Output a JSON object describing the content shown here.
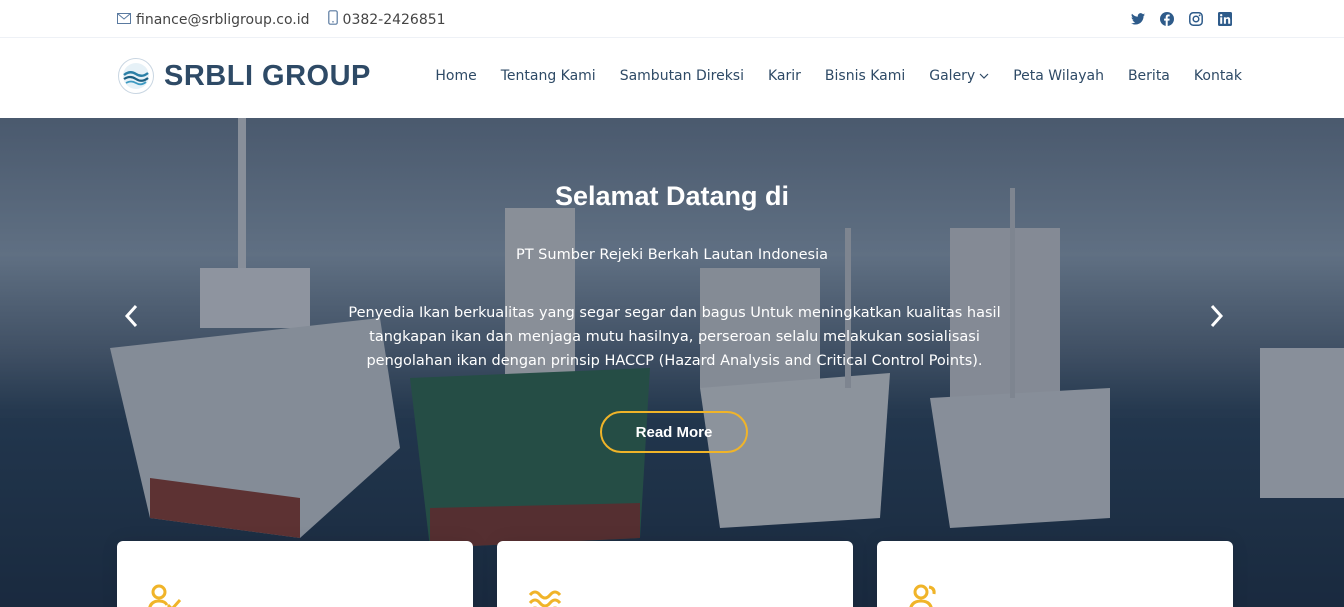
{
  "topbar": {
    "email": "finance@srbligroup.co.id",
    "phone": "0382-2426851",
    "social": [
      "twitter-icon",
      "facebook-icon",
      "instagram-icon",
      "linkedin-icon"
    ]
  },
  "header": {
    "logo_text": "SRBLI GROUP",
    "nav": [
      "Home",
      "Tentang Kami",
      "Sambutan Direksi",
      "Karir",
      "Bisnis Kami",
      "Galery",
      "Peta Wilayah",
      "Berita",
      "Kontak"
    ]
  },
  "hero": {
    "title": "Selamat Datang di",
    "subtitle": "PT Sumber Rejeki Berkah Lautan Indonesia",
    "description": "Penyedia Ikan berkualitas yang segar segar dan bagus Untuk meningkatkan kualitas hasil tangkapan ikan dan menjaga mutu hasilnya, perseroan selalu melakukan sosialisasi pengolahan ikan dengan prinsip HACCP (Hazard Analysis and Critical Control Points).",
    "button_label": "Read More"
  },
  "colors": {
    "accent": "#f0b429",
    "brand": "#2e4a66"
  }
}
